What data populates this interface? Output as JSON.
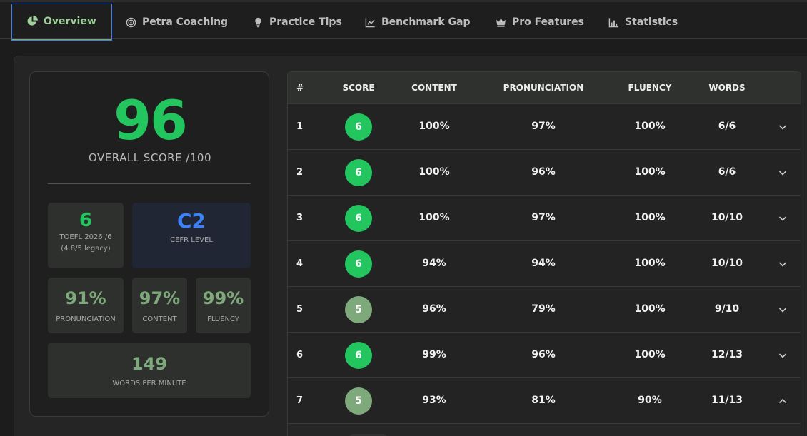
{
  "tabs": [
    {
      "label": "Overview",
      "icon": "pie-chart-icon",
      "active": true
    },
    {
      "label": "Petra Coaching",
      "icon": "target-icon",
      "active": false
    },
    {
      "label": "Practice Tips",
      "icon": "lightbulb-icon",
      "active": false
    },
    {
      "label": "Benchmark Gap",
      "icon": "line-chart-icon",
      "active": false
    },
    {
      "label": "Pro Features",
      "icon": "crown-icon",
      "active": false
    },
    {
      "label": "Statistics",
      "icon": "bar-chart-icon",
      "active": false
    }
  ],
  "summary": {
    "overall_score": "96",
    "overall_label": "OVERALL SCORE /100",
    "toefl": {
      "value": "6",
      "label": "TOEFL 2026 /6",
      "sub": "(4.8/5 legacy)"
    },
    "cefr": {
      "value": "C2",
      "label": "CEFR LEVEL"
    },
    "pronunciation": {
      "value": "91%",
      "label": "PRONUNCIATION"
    },
    "content": {
      "value": "97%",
      "label": "CONTENT"
    },
    "fluency": {
      "value": "99%",
      "label": "FLUENCY"
    },
    "wpm": {
      "value": "149",
      "label": "WORDS PER MINUTE"
    }
  },
  "table": {
    "headers": {
      "num": "#",
      "score": "SCORE",
      "content": "CONTENT",
      "pronunciation": "PRONUNCIATION",
      "fluency": "FLUENCY",
      "words": "WORDS"
    },
    "rows": [
      {
        "num": "1",
        "score": "6",
        "content": "100%",
        "pronunciation": "97%",
        "fluency": "100%",
        "words": "6/6",
        "expanded": false
      },
      {
        "num": "2",
        "score": "6",
        "content": "100%",
        "pronunciation": "96%",
        "fluency": "100%",
        "words": "6/6",
        "expanded": false
      },
      {
        "num": "3",
        "score": "6",
        "content": "100%",
        "pronunciation": "97%",
        "fluency": "100%",
        "words": "10/10",
        "expanded": false
      },
      {
        "num": "4",
        "score": "6",
        "content": "94%",
        "pronunciation": "94%",
        "fluency": "100%",
        "words": "10/10",
        "expanded": false
      },
      {
        "num": "5",
        "score": "5",
        "content": "96%",
        "pronunciation": "79%",
        "fluency": "100%",
        "words": "9/10",
        "expanded": false
      },
      {
        "num": "6",
        "score": "6",
        "content": "99%",
        "pronunciation": "96%",
        "fluency": "100%",
        "words": "12/13",
        "expanded": false
      },
      {
        "num": "7",
        "score": "5",
        "content": "93%",
        "pronunciation": "81%",
        "fluency": "90%",
        "words": "11/13",
        "expanded": true
      }
    ]
  },
  "colors": {
    "score_6": "#22c55e",
    "score_5": "#7ea97a",
    "accent_blue": "#3b82f6"
  }
}
